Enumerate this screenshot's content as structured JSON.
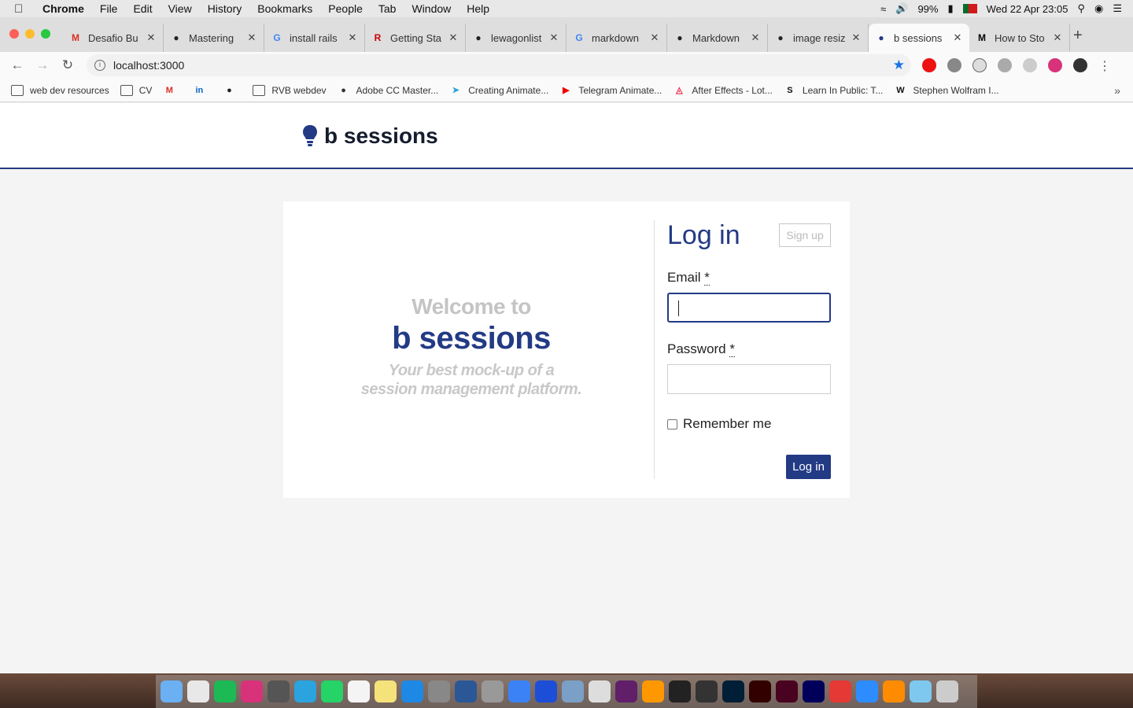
{
  "menubar": {
    "app": "Chrome",
    "items": [
      "File",
      "Edit",
      "View",
      "History",
      "Bookmarks",
      "People",
      "Tab",
      "Window",
      "Help"
    ],
    "battery": "99%",
    "datetime": "Wed 22 Apr  23:05"
  },
  "tabs": [
    {
      "title": "Desafio Bu",
      "icon": "gmail-icon",
      "glyph": "M",
      "color": "#d93025"
    },
    {
      "title": "Mastering",
      "icon": "github-icon",
      "glyph": "●",
      "color": "#222"
    },
    {
      "title": "install rails",
      "icon": "google-icon",
      "glyph": "G",
      "color": "#4285f4"
    },
    {
      "title": "Getting Sta",
      "icon": "rails-icon",
      "glyph": "R",
      "color": "#cc0000"
    },
    {
      "title": "lewagonlist",
      "icon": "github-icon",
      "glyph": "●",
      "color": "#222"
    },
    {
      "title": "markdown",
      "icon": "google-icon",
      "glyph": "G",
      "color": "#4285f4"
    },
    {
      "title": "Markdown",
      "icon": "github-icon",
      "glyph": "●",
      "color": "#222"
    },
    {
      "title": "image resiz",
      "icon": "github-icon",
      "glyph": "●",
      "color": "#222"
    },
    {
      "title": "b sessions",
      "icon": "bulb-icon",
      "glyph": "●",
      "color": "#233a85",
      "active": true
    },
    {
      "title": "How to Sto",
      "icon": "medium-icon",
      "glyph": "M",
      "color": "#000"
    }
  ],
  "address": {
    "url": "localhost:3000"
  },
  "bookmarks": [
    {
      "label": "web dev resources",
      "icon": "folder-icon"
    },
    {
      "label": "CV",
      "icon": "folder-icon"
    },
    {
      "label": "",
      "icon": "gmail-icon",
      "glyph": "M",
      "color": "#d93025"
    },
    {
      "label": "",
      "icon": "linkedin-icon",
      "glyph": "in",
      "color": "#0a66c2"
    },
    {
      "label": "",
      "icon": "github-icon",
      "glyph": "●",
      "color": "#222"
    },
    {
      "label": "RVB webdev",
      "icon": "folder-icon"
    },
    {
      "label": "Adobe CC Master...",
      "icon": "udemy-icon",
      "glyph": "●",
      "color": "#333"
    },
    {
      "label": "Creating Animate...",
      "icon": "telegram-icon",
      "glyph": "➤",
      "color": "#2aa3df"
    },
    {
      "label": "Telegram Animate...",
      "icon": "youtube-icon",
      "glyph": "▶",
      "color": "#e00"
    },
    {
      "label": "After Effects - Lot...",
      "icon": "lottie-icon",
      "glyph": "◬",
      "color": "#e24"
    },
    {
      "label": "Learn In Public: T...",
      "icon": "swyx-icon",
      "glyph": "S",
      "color": "#111"
    },
    {
      "label": "Stephen Wolfram I...",
      "icon": "wolfram-icon",
      "glyph": "W",
      "color": "#111"
    }
  ],
  "site": {
    "brand": "b sessions",
    "welcome_line1": "Welcome to",
    "welcome_line2": "b sessions",
    "tagline_line1": "Your best mock-up of a",
    "tagline_line2": "session management platform."
  },
  "login": {
    "title": "Log in",
    "signup_label": "Sign up",
    "email_label": "Email",
    "password_label": "Password",
    "required_mark": "*",
    "remember_label": "Remember me",
    "submit_label": "Log in",
    "email_value": "",
    "password_value": ""
  },
  "colors": {
    "brand": "#233a85",
    "accent_star": "#1a73e8"
  },
  "dock": [
    "finder",
    "chrome",
    "spotify",
    "instagram",
    "screenshot",
    "telegram",
    "whatsapp",
    "calendar",
    "notes",
    "app-store",
    "system-preferences",
    "word",
    "preview",
    "quicktime",
    "zoom-clone",
    "vpn",
    "scripts",
    "slack",
    "sublime",
    "terminal",
    "github",
    "photoshop",
    "illustrator",
    "indesign",
    "after-effects",
    "hand",
    "zoom",
    "infuse",
    "folder",
    "trash"
  ]
}
